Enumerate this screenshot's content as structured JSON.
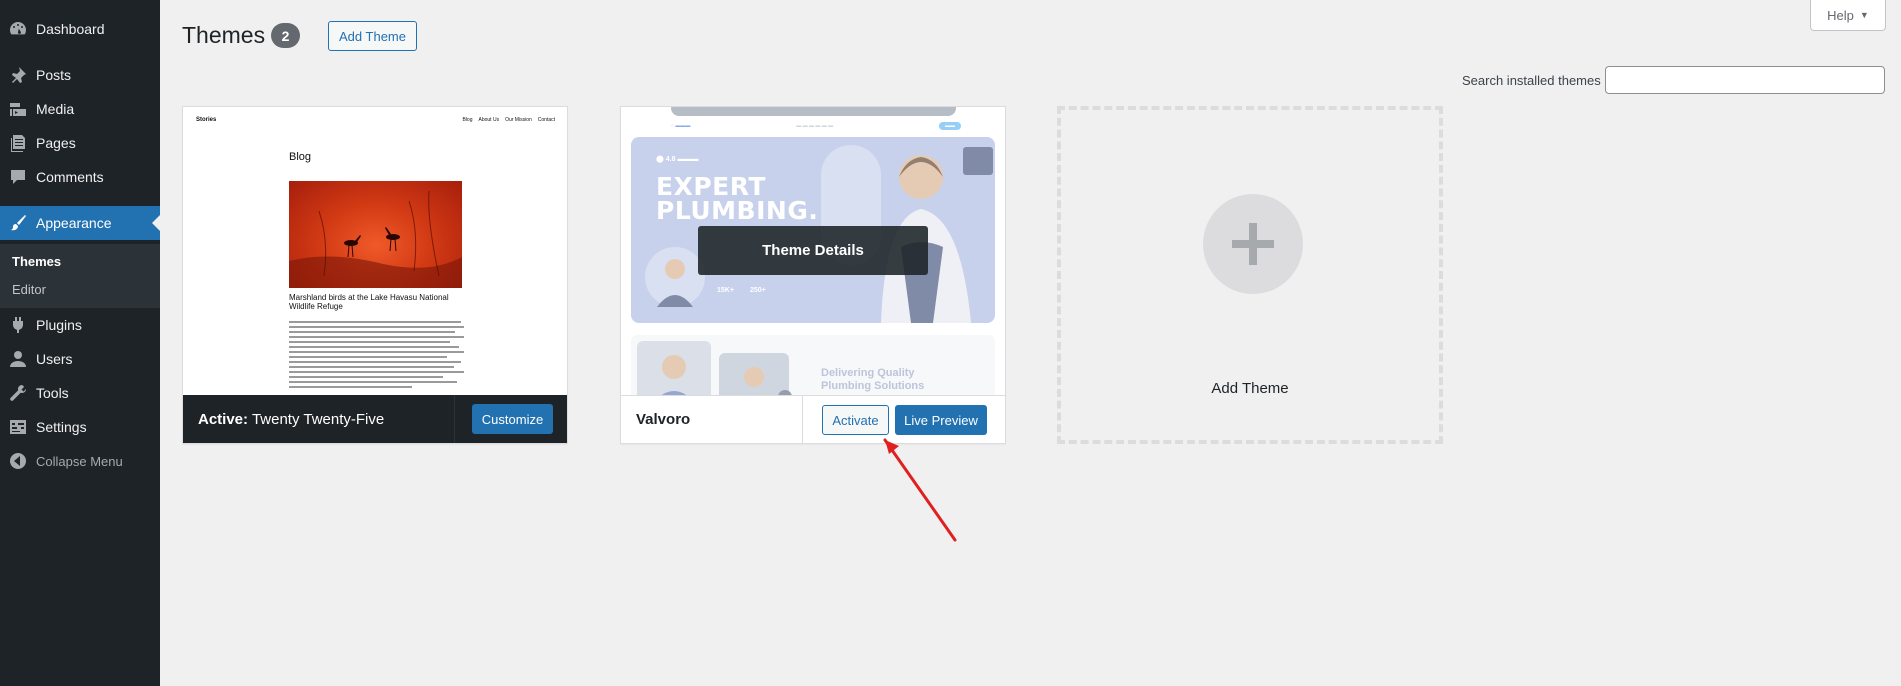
{
  "sidebar": {
    "items": [
      {
        "label": "Dashboard",
        "icon": "dashboard-icon"
      },
      {
        "label": "Posts",
        "icon": "pin-icon"
      },
      {
        "label": "Media",
        "icon": "media-icon"
      },
      {
        "label": "Pages",
        "icon": "pages-icon"
      },
      {
        "label": "Comments",
        "icon": "comment-icon"
      },
      {
        "label": "Appearance",
        "icon": "brush-icon"
      },
      {
        "label": "Plugins",
        "icon": "plug-icon"
      },
      {
        "label": "Users",
        "icon": "user-icon"
      },
      {
        "label": "Tools",
        "icon": "wrench-icon"
      },
      {
        "label": "Settings",
        "icon": "settings-icon"
      },
      {
        "label": "Collapse Menu",
        "icon": "collapse-icon"
      }
    ],
    "submenu": [
      {
        "label": "Themes"
      },
      {
        "label": "Editor"
      }
    ]
  },
  "header": {
    "title": "Themes",
    "count": "2",
    "add_button": "Add Theme",
    "help": "Help",
    "search_label": "Search installed themes",
    "search_value": ""
  },
  "themes": [
    {
      "active_prefix": "Active:",
      "name": "Twenty Twenty-Five",
      "button": "Customize",
      "preview": {
        "site_title": "Stories",
        "nav": [
          "Blog",
          "About Us",
          "Our Mission",
          "Contact"
        ],
        "heading": "Blog",
        "caption": "Marshland birds at the Lake Havasu National Wildlife Refuge"
      }
    },
    {
      "name": "Valvoro",
      "details": "Theme Details",
      "activate": "Activate",
      "live_preview": "Live Preview",
      "preview": {
        "hero": "EXPERT PLUMBING.",
        "stat1": "15K+",
        "stat2": "250+",
        "tagline": "Delivering Quality Plumbing Solutions"
      }
    }
  ],
  "add_new": {
    "label": "Add Theme"
  },
  "colors": {
    "accent": "#2271b1",
    "sidebar": "#1d2327",
    "annotation": "#e02020"
  }
}
